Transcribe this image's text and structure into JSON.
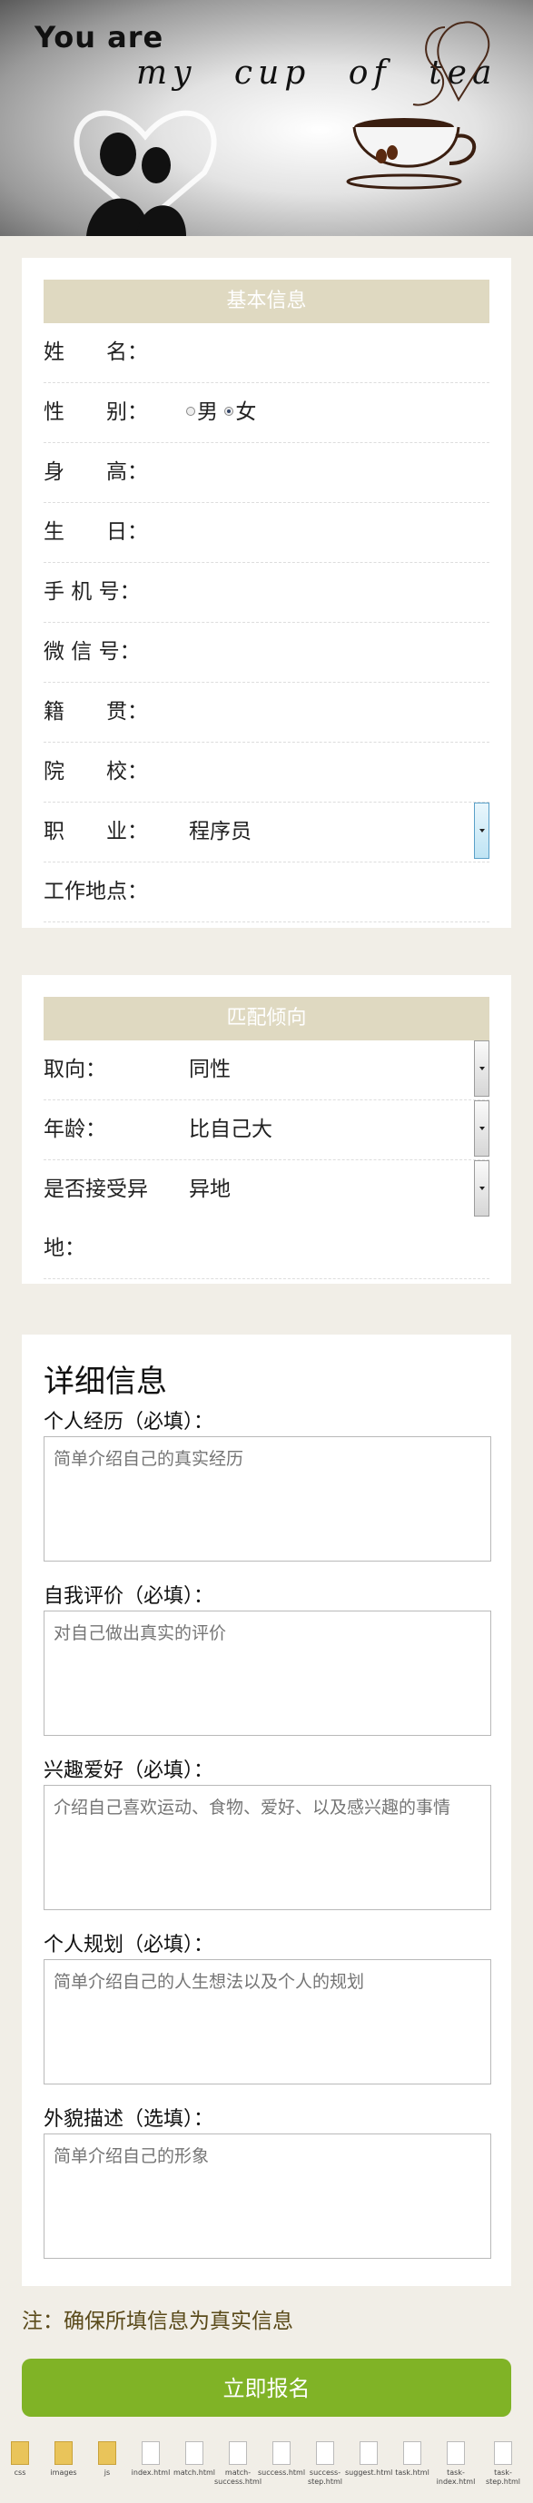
{
  "banner": {
    "line1": "You are",
    "line2": "my cup of tea"
  },
  "basic": {
    "header": "基本信息",
    "fields": [
      {
        "label": "姓　　名："
      },
      {
        "label": "性　　别：",
        "radio_male": "男",
        "radio_female": "女"
      },
      {
        "label": "身　　高："
      },
      {
        "label": "生　　日："
      },
      {
        "label": "手 机 号："
      },
      {
        "label": "微 信 号："
      },
      {
        "label": "籍　　贯："
      },
      {
        "label": "院　　校："
      },
      {
        "label": "职　　业：",
        "value": "程序员"
      },
      {
        "label": "工作地点："
      }
    ]
  },
  "match": {
    "header": "匹配倾向",
    "orientation": {
      "label": "取向：",
      "value": "同性"
    },
    "age": {
      "label": "年龄：",
      "value": "比自己大"
    },
    "distance": {
      "label_line1": "是否接受异",
      "label_line2": "地：",
      "value": "异地"
    }
  },
  "detail": {
    "title": "详细信息",
    "experience": {
      "label": "个人经历（必填）：",
      "placeholder": "简单介绍自己的真实经历"
    },
    "self_eval": {
      "label": "自我评价（必填）：",
      "placeholder": "对自己做出真实的评价"
    },
    "hobbies": {
      "label": "兴趣爱好（必填）：",
      "placeholder": "介绍自己喜欢运动、食物、爱好、以及感兴趣的事情"
    },
    "plan": {
      "label": "个人规划（必填）：",
      "placeholder": "简单介绍自己的人生想法以及个人的规划"
    },
    "appearance": {
      "label": "外貌描述（选填）：",
      "placeholder": "简单介绍自己的形象"
    }
  },
  "note": "注：确保所填信息为真实信息",
  "submit_label": "立即报名",
  "file_bar": [
    {
      "name": "css",
      "type": "folder"
    },
    {
      "name": "images",
      "type": "folder"
    },
    {
      "name": "js",
      "type": "folder"
    },
    {
      "name": "index.html",
      "type": "file"
    },
    {
      "name": "match.html",
      "type": "file"
    },
    {
      "name": "match-success.html",
      "type": "file"
    },
    {
      "name": "success.html",
      "type": "file"
    },
    {
      "name": "success-step.html",
      "type": "file"
    },
    {
      "name": "suggest.html",
      "type": "file"
    },
    {
      "name": "task.html",
      "type": "file"
    },
    {
      "name": "task-index.html",
      "type": "file"
    },
    {
      "name": "task-step.html",
      "type": "file"
    }
  ]
}
